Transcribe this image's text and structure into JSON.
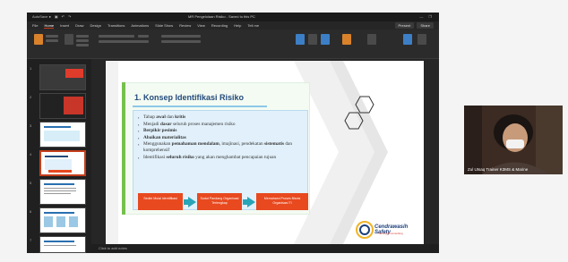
{
  "app": {
    "window_title": "MR Pengelolaan Risiko - Saved to this PC",
    "menu_tabs": [
      "File",
      "Home",
      "Insert",
      "Draw",
      "Design",
      "Transitions",
      "Animations",
      "Slide Show",
      "Review",
      "View",
      "Recording",
      "Help",
      "Tell me"
    ],
    "active_tab": "Home",
    "right_buttons": [
      "Present",
      "Share"
    ]
  },
  "slide": {
    "title": "1. Konsep Identifikasi Risiko",
    "bullets": [
      {
        "pre": "Tahap ",
        "bold": "awal",
        "mid": " dan ",
        "bold2": "kritis",
        "post": ""
      },
      {
        "pre": "Menjadi ",
        "bold": "dasar",
        "mid": " seluruh proses manajemen risiko",
        "bold2": "",
        "post": ""
      },
      {
        "pre": "",
        "bold": "Berpikir pesimis",
        "mid": "",
        "bold2": "",
        "post": ""
      },
      {
        "pre": "",
        "bold": "Abaikan materialitas",
        "mid": "",
        "bold2": "",
        "post": ""
      },
      {
        "pre": "Menggunakan ",
        "bold": "pemahaman mendalam",
        "mid": ", imajinasi, pendekatan ",
        "bold2": "sistematis",
        "post": " dan komprehensif"
      },
      {
        "pre": "Identifikasi ",
        "bold": "seluruh risiko",
        "mid": " yang akan menghambat pencapaian tujuan",
        "bold2": "",
        "post": ""
      }
    ],
    "flow": [
      "Sedini Mulai Identifikasi",
      "Sudut Pandang Organisasi Terlengkap",
      "Memahami Proses Bisnis Organisasi TI"
    ],
    "logo_text": "Cendrawasih Safety",
    "logo_subtext": "Training & Consulting"
  },
  "status": {
    "notes_hint": "Click to add notes"
  },
  "thumbnails": [
    {
      "num": "1"
    },
    {
      "num": "2"
    },
    {
      "num": "3"
    },
    {
      "num": "4"
    },
    {
      "num": "5"
    },
    {
      "num": "6"
    },
    {
      "num": "7"
    }
  ],
  "webcam": {
    "participant_name": "Zul Utsaq Trainer K3MS & Marine"
  },
  "colors": {
    "accent_orange": "#e8491f",
    "flow_arrow": "#2aa5b8",
    "title_blue": "#234b7c",
    "green_accent": "#76c04e"
  }
}
